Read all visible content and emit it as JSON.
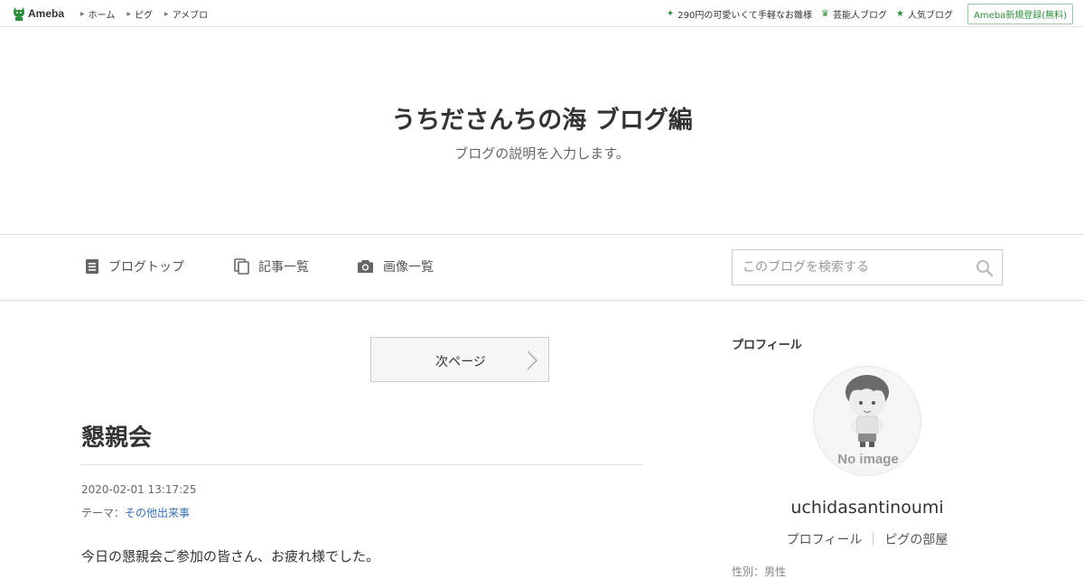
{
  "topbar": {
    "logo_text": "Ameba",
    "nav": [
      "ホーム",
      "ピグ",
      "アメブロ"
    ],
    "right_links": [
      {
        "icon": "sparkle-icon",
        "label": "290円の可愛いくて手軽なお雛様"
      },
      {
        "icon": "crown-icon",
        "label": "芸能人ブログ"
      },
      {
        "icon": "star-icon",
        "label": "人気ブログ"
      }
    ],
    "signup_label": "Ameba新規登録(無料)",
    "accent_color": "#2d8c3c"
  },
  "header": {
    "title": "うちださんちの海 ブログ編",
    "description": "ブログの説明を入力します。"
  },
  "navbar": {
    "items": [
      {
        "icon": "document-icon",
        "label": "ブログトップ"
      },
      {
        "icon": "copy-list-icon",
        "label": "記事一覧"
      },
      {
        "icon": "camera-icon",
        "label": "画像一覧"
      }
    ],
    "search_placeholder": "このブログを検索する"
  },
  "main": {
    "next_page_label": "次ページ",
    "entry": {
      "title": "懇親会",
      "datetime": "2020-02-01 13:17:25",
      "theme_prefix": "テーマ：",
      "theme_link": "その他出来事",
      "body_first_line": "今日の懇親会ご参加の皆さん、お疲れ様でした。"
    }
  },
  "sidebar": {
    "heading": "プロフィール",
    "avatar_text": "No image",
    "username": "uchidasantinoumi",
    "links": [
      "プロフィール",
      "ピグの部屋"
    ],
    "cut_text": "性別：男性"
  }
}
